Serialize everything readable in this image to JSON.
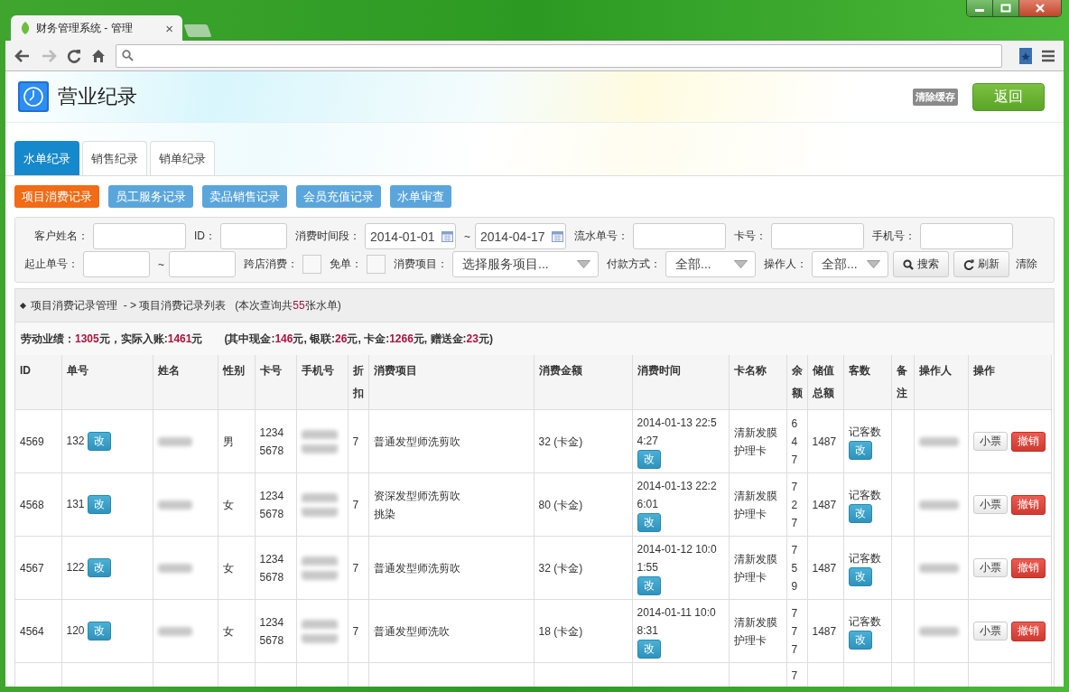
{
  "browser": {
    "tab_title": "财务管理系统 - 管理",
    "tab_close": "×"
  },
  "page": {
    "title": "营业纪录",
    "clear_cache": "清除缓存",
    "back": "返回"
  },
  "tabs": [
    {
      "label": "水单纪录",
      "selected": true
    },
    {
      "label": "销售纪录",
      "selected": false
    },
    {
      "label": "销单纪录",
      "selected": false
    }
  ],
  "subnav": [
    {
      "label": "项目消费记录",
      "selected": true
    },
    {
      "label": "员工服务记录",
      "selected": false
    },
    {
      "label": "卖品销售记录",
      "selected": false
    },
    {
      "label": "会员充值记录",
      "selected": false
    },
    {
      "label": "水单审查",
      "selected": false
    }
  ],
  "filters": [
    [
      {
        "kind": "input",
        "label": "客户姓名："
      },
      {
        "kind": "input",
        "label": "ID："
      },
      {
        "kind": "daterange",
        "label": "消费时间段：",
        "from": "2014-01-01",
        "sep": "~",
        "to": "2014-04-17"
      },
      {
        "kind": "input",
        "label": "流水单号："
      },
      {
        "kind": "input",
        "label": "卡号："
      },
      {
        "kind": "input",
        "label": "手机号："
      }
    ],
    [
      {
        "kind": "range",
        "label": "起止单号：",
        "sep": "~"
      },
      {
        "kind": "checkbox",
        "label": "跨店消费：",
        "checked": false
      },
      {
        "kind": "checkbox",
        "label": "免单：",
        "checked": false
      },
      {
        "kind": "select",
        "label": "消费项目：",
        "value": "选择服务项目..."
      },
      {
        "kind": "select",
        "label": "付款方式：",
        "value": "全部..."
      },
      {
        "kind": "select",
        "label": "操作人：",
        "value": "全部..."
      },
      {
        "kind": "search",
        "label": "搜索"
      },
      {
        "kind": "refresh",
        "label": "刷新"
      },
      {
        "kind": "link",
        "label": "清除"
      }
    ]
  ],
  "breadcrumb": {
    "section": "项目消费记录管理",
    "arrow": "- >",
    "page": "项目消费记录列表",
    "count_before": "(本次查询共",
    "count": "55",
    "count_after": "张水单)"
  },
  "summary": [
    {
      "label": "劳动业绩：",
      "value": "1305",
      "unit": "元，"
    },
    {
      "label": "实际入账:",
      "value": "1461",
      "unit": "元"
    }
  ],
  "breakdown": [
    {
      "label": "(其中现金:",
      "value": "146",
      "unit": "元, "
    },
    {
      "label": "银联:",
      "value": "26",
      "unit": "元, "
    },
    {
      "label": "卡金:",
      "value": "1266",
      "unit": "元, "
    },
    {
      "label": "赠送金:",
      "value": "23",
      "unit": "元)"
    }
  ],
  "table": {
    "columns": [
      "ID",
      "单号",
      "姓名",
      "性别",
      "卡号",
      "手机号",
      "折扣",
      "消费项目",
      "消费金额",
      "消费时间",
      "卡名称",
      "余额",
      "储值总额",
      "客数",
      "备注",
      "操作人",
      "操作"
    ],
    "rows": [
      {
        "kind": "full",
        "id": "4569",
        "no": "132",
        "edit_no": "改",
        "gender": "男",
        "card": "1234 5678",
        "discount": "7",
        "items": [
          "普通发型师洗剪吹"
        ],
        "amount": "32 (卡金)",
        "time": "2014-01-13 22:54:27",
        "edit_time": "改",
        "card_name": "清新发膜护理卡",
        "balance": "647",
        "total": "1487",
        "guest": "记客数",
        "edit_guest": "改",
        "receipt": "小票",
        "revoke": "撤销"
      },
      {
        "kind": "full",
        "id": "4568",
        "no": "131",
        "edit_no": "改",
        "gender": "女",
        "card": "1234 5678",
        "discount": "7",
        "items": [
          "资深发型师洗剪吹",
          "挑染"
        ],
        "amount": "80 (卡金)",
        "time": "2014-01-13 22:26:01",
        "edit_time": "改",
        "card_name": "清新发膜护理卡",
        "balance": "727",
        "total": "1487",
        "guest": "记客数",
        "edit_guest": "改",
        "receipt": "小票",
        "revoke": "撤销"
      },
      {
        "kind": "full",
        "id": "4567",
        "no": "122",
        "edit_no": "改",
        "gender": "女",
        "card": "1234 5678",
        "discount": "7",
        "items": [
          "普通发型师洗剪吹"
        ],
        "amount": "32 (卡金)",
        "time": "2014-01-12 10:01:55",
        "edit_time": "改",
        "card_name": "清新发膜护理卡",
        "balance": "759",
        "total": "1487",
        "guest": "记客数",
        "edit_guest": "改",
        "receipt": "小票",
        "revoke": "撤销"
      },
      {
        "kind": "full",
        "id": "4564",
        "no": "120",
        "edit_no": "改",
        "gender": "女",
        "card": "1234 5678",
        "discount": "7",
        "items": [
          "普通发型师洗吹"
        ],
        "amount": "18 (卡金)",
        "time": "2014-01-11 10:08:31",
        "edit_time": "改",
        "card_name": "清新发膜护理卡",
        "balance": "777",
        "total": "1487",
        "guest": "记客数",
        "edit_guest": "改",
        "receipt": "小票",
        "revoke": "撤销"
      },
      {
        "kind": "partial",
        "balance": "7"
      }
    ]
  }
}
